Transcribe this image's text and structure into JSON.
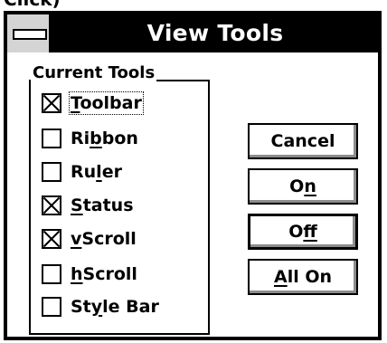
{
  "page": {
    "top_fragment": "Click)"
  },
  "dialog": {
    "title": "View Tools",
    "group_label": "Current Tools",
    "checkboxes": [
      {
        "pre": "",
        "key": "T",
        "post": "oolbar",
        "checked": true,
        "focused": true
      },
      {
        "pre": "Ri",
        "key": "b",
        "post": "bon",
        "checked": false
      },
      {
        "pre": "Ru",
        "key": "l",
        "post": "er",
        "checked": false
      },
      {
        "pre": "",
        "key": "S",
        "post": "tatus",
        "checked": true
      },
      {
        "pre": "",
        "key": "v",
        "post": "Scroll",
        "checked": true
      },
      {
        "pre": "",
        "key": "h",
        "post": "Scroll",
        "checked": false
      },
      {
        "pre": "St",
        "key": "y",
        "post": "le Bar",
        "checked": false
      }
    ],
    "buttons": {
      "cancel": {
        "label": "Cancel"
      },
      "on": {
        "pre": "O",
        "key": "n",
        "post": ""
      },
      "off": {
        "pre": "O",
        "key": "f",
        "post": "f"
      },
      "all_on": {
        "pre": "",
        "key": "A",
        "post": "ll On"
      }
    }
  },
  "icons": {
    "system_menu": "system-menu-icon",
    "check": "checkbox-x-mark"
  },
  "colors": {
    "titlebar": "#000000",
    "background": "#ffffff",
    "button_shadow": "#8c8c8c",
    "sysmenu": "#d4d4d4"
  }
}
